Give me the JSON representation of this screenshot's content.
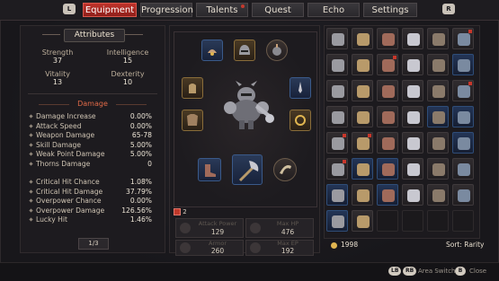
{
  "tabs": {
    "left_button": "L",
    "right_button": "R",
    "items": [
      {
        "label": "Equipment",
        "active": true
      },
      {
        "label": "Progression",
        "active": false
      },
      {
        "label": "Talents",
        "active": false
      },
      {
        "label": "Quest",
        "active": false
      },
      {
        "label": "Echo",
        "active": false
      },
      {
        "label": "Settings",
        "active": false
      }
    ]
  },
  "attributes": {
    "title": "Attributes",
    "strength_label": "Strength",
    "strength": "37",
    "intelligence_label": "Intelligence",
    "intelligence": "15",
    "vitality_label": "Vitality",
    "vitality": "13",
    "dexterity_label": "Dexterity",
    "dexterity": "10",
    "damage_header": "Damage",
    "damage": [
      {
        "label": "Damage Increase",
        "value": "0.00%"
      },
      {
        "label": "Attack Speed",
        "value": "0.00%"
      },
      {
        "label": "Weapon Damage",
        "value": "65-78"
      },
      {
        "label": "Skill Damage",
        "value": "5.00%"
      },
      {
        "label": "Weak Point Damage",
        "value": "5.00%"
      },
      {
        "label": "Thorns Damage",
        "value": "0"
      }
    ],
    "critical": [
      {
        "label": "Critical Hit Chance",
        "value": "1.08%"
      },
      {
        "label": "Critical Hit Damage",
        "value": "37.79%"
      },
      {
        "label": "Overpower Chance",
        "value": "0.00%"
      },
      {
        "label": "Overpower Damage",
        "value": "126.56%"
      },
      {
        "label": "Lucky Hit",
        "value": "1.46%"
      }
    ],
    "page": "1/3"
  },
  "equipment": {
    "gem_count": "2",
    "stats": [
      {
        "name": "Attack Power",
        "value": "129",
        "icon": "sword-icon"
      },
      {
        "name": "Max HP",
        "value": "476",
        "icon": "heart-icon"
      },
      {
        "name": "Armor",
        "value": "260",
        "icon": "shield-icon"
      },
      {
        "name": "Max EP",
        "value": "192",
        "icon": "bolt-icon"
      }
    ]
  },
  "inventory": {
    "gold": "1998",
    "sort_label": "Sort: Rarity"
  },
  "footer": {
    "lb": "LB",
    "rb": "RB",
    "area_switch": "Area Switch",
    "b": "B",
    "close": "Close"
  },
  "colors": {
    "accent": "#c0332b",
    "rare": "#2f4d78",
    "gold": "#e0b550"
  }
}
